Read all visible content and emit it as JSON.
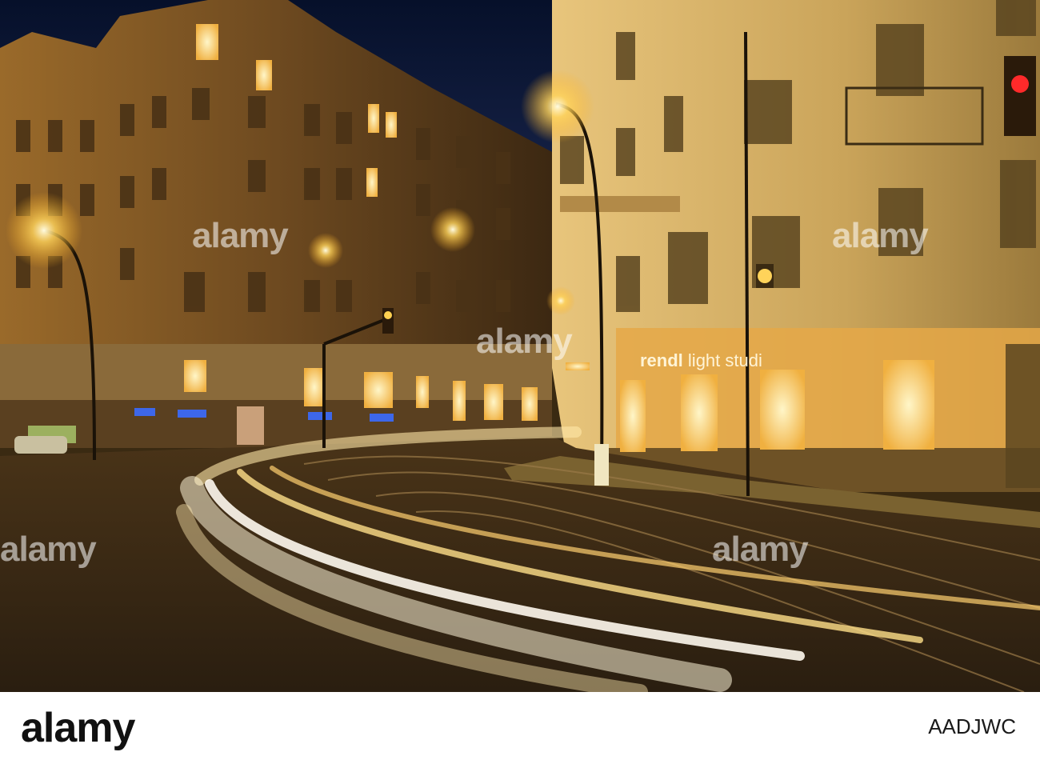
{
  "photo": {
    "scene": "night street with light trails",
    "colors": {
      "sky": "#0a1530",
      "building_left": "#6b4a22",
      "building_right": "#caa45a",
      "street": "#3b2a15",
      "light_trail": "#fff3c8",
      "lamp": "#ffd35a"
    },
    "shop_sign": {
      "word_one": "rendl",
      "word_two": "light studi"
    },
    "watermark_text": "alamy"
  },
  "footer": {
    "logo_text": "alamy",
    "image_id": "AADJWC"
  }
}
